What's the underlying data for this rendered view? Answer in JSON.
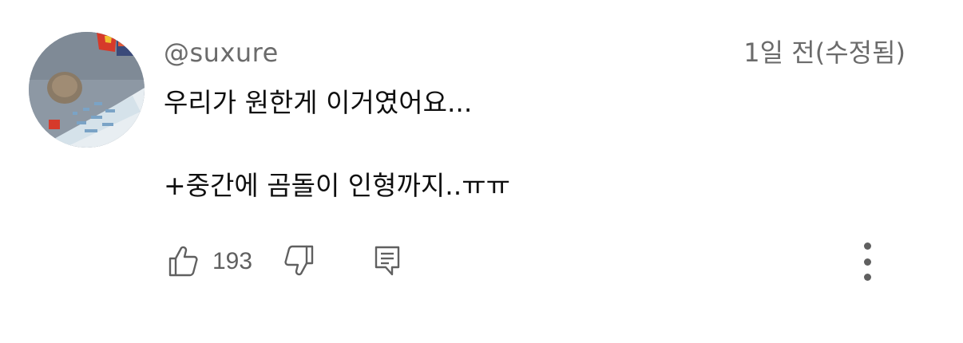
{
  "comment": {
    "author": "@suxure",
    "timestamp": "1일 전(수정됨)",
    "lines": [
      "우리가 원한게 이거였어요...",
      "+중간에 곰돌이 인형까지..ㅠㅠ"
    ],
    "avatar_description": "photo-thumbnail"
  },
  "actions": {
    "like_icon": "thumbs-up-icon",
    "like_count": "193",
    "dislike_icon": "thumbs-down-icon",
    "reply_icon": "reply-comment-icon",
    "more_icon": "more-vertical-icon"
  },
  "colors": {
    "secondary_text": "#6b6b6b",
    "primary_text": "#0f0f0f",
    "icon": "#606060"
  }
}
